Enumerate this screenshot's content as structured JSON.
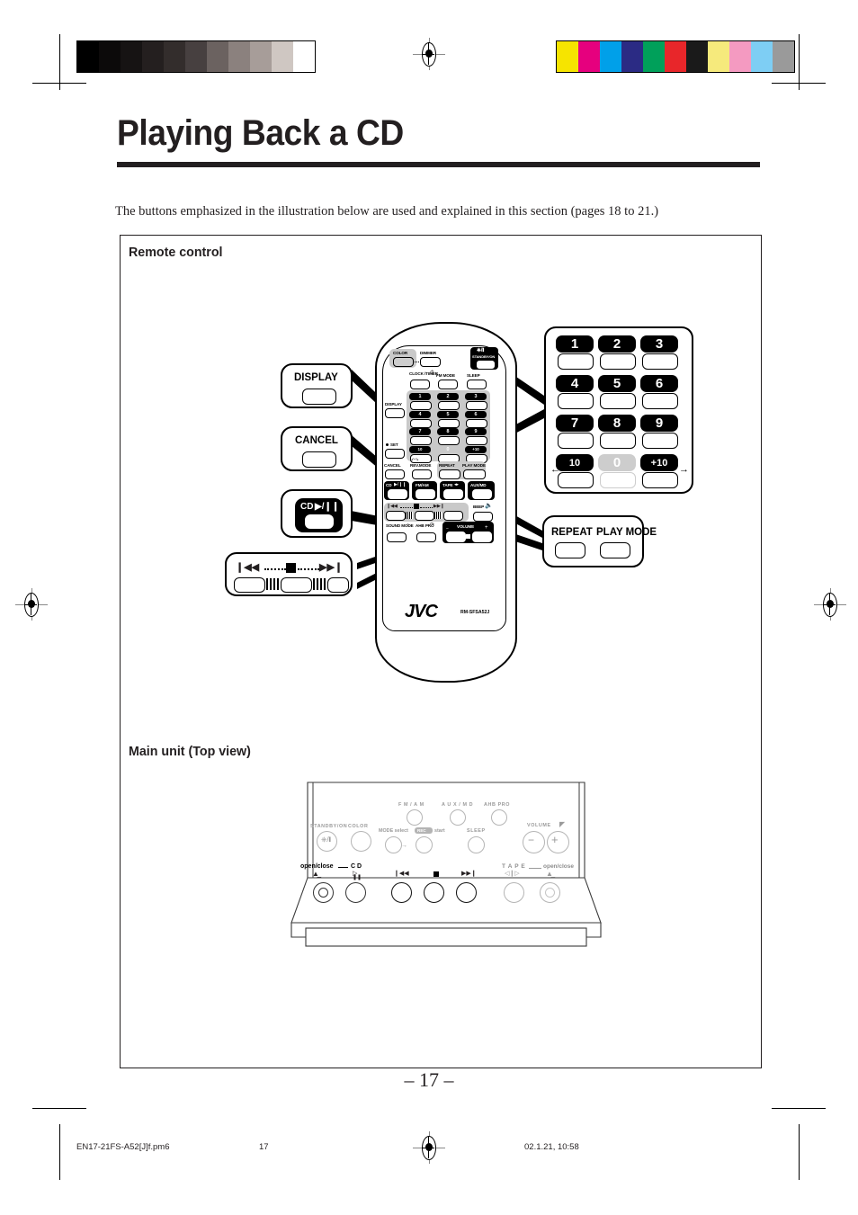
{
  "document": {
    "title": "Playing Back a CD",
    "intro": "The buttons emphasized in the illustration below are used and explained in this section (pages 18 to 21.)",
    "page_number": "– 17 –"
  },
  "footer": {
    "filename": "EN17-21FS-A52[J]f.pm6",
    "page": "17",
    "timestamp": "02.1.21, 10:58"
  },
  "sections": {
    "remote_heading": "Remote control",
    "main_unit_heading": "Main unit (Top view)"
  },
  "callouts": [
    {
      "id": "display",
      "label": "DISPLAY"
    },
    {
      "id": "cancel",
      "label": "CANCEL"
    },
    {
      "id": "cd_play",
      "label": "CD"
    },
    {
      "id": "skip",
      "label": ""
    },
    {
      "id": "numeric",
      "label": ""
    },
    {
      "id": "repeat",
      "label_a": "REPEAT",
      "label_b": "PLAY MODE"
    }
  ],
  "numeric_keypad": {
    "keys": [
      "1",
      "2",
      "3",
      "4",
      "5",
      "6",
      "7",
      "8",
      "9",
      "10",
      "0",
      "+10"
    ],
    "dim_key": "0"
  },
  "remote": {
    "brand": "JVC",
    "model": "RM-SFSA52J",
    "buttons": {
      "color": "COLOR",
      "dimmer": "DIMMER",
      "standby": "STANDBY/ON",
      "clock_timer": "CLOCK /TIMER",
      "fm_mode": "FM MODE",
      "sleep": "SLEEP",
      "display": "DISPLAY",
      "set": "SET",
      "cancel": "CANCEL",
      "rev_mode": "REV.MODE",
      "repeat": "REPEAT",
      "play_mode": "PLAY MODE",
      "cd": "CD",
      "fm_am": "FM/AM",
      "tape": "TAPE",
      "aux_md": "AUX/MD",
      "beep": "BEEP",
      "sound_mode": "SOUND MODE",
      "ahb_pro": "AHB PRO",
      "volume": "VOLUME"
    },
    "keypad": [
      "1",
      "2",
      "3",
      "4",
      "5",
      "6",
      "7",
      "8",
      "9",
      "10",
      "0",
      "+10"
    ]
  },
  "main_unit": {
    "labels": {
      "fm_am": "F M / A M",
      "aux_md": "A U X / M D",
      "ahb_pro": "AHB PRO",
      "mode_select": "MODE select",
      "rec": "REC",
      "start": "start",
      "sleep": "SLEEP",
      "standby": "STANDBY/ON",
      "color": "COLOR",
      "volume": "VOLUME",
      "open_close_cd": "open/close",
      "cd": "C D",
      "tape": "T A P E",
      "open_close_tape": "open/close"
    }
  },
  "colors": {
    "ink": "#231f20",
    "grey_key": "#c9c9c9",
    "bar_colors_left": [
      "#000000",
      "#0c0a0a",
      "#161313",
      "#241f1f",
      "#332d2c",
      "#474040",
      "#6b6260",
      "#8b817e",
      "#a79d99",
      "#cfc7c2",
      "#ffffff"
    ],
    "bar_colors_right": [
      "#f6e400",
      "#e6007e",
      "#00a0e9",
      "#2b2b84",
      "#00a05a",
      "#e8262a",
      "#1a1a1a",
      "#f6ea7c",
      "#f49ac1",
      "#7ecef4",
      "#9a9a9a"
    ]
  }
}
